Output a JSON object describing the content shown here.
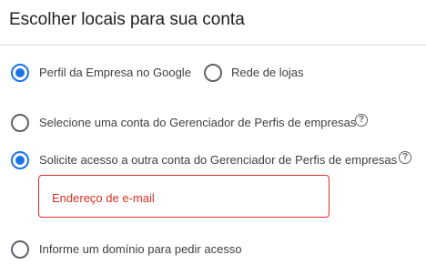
{
  "dialog": {
    "title": "Escolher locais para sua conta"
  },
  "source_options": [
    {
      "label": "Perfil da Empresa no Google",
      "selected": true
    },
    {
      "label": "Rede de lojas",
      "selected": false
    }
  ],
  "access_options": [
    {
      "label": "Selecione uma conta do Gerenciador de Perfis de empresas",
      "selected": false,
      "help_icon": "help-circle-icon"
    },
    {
      "label": "Solicite acesso a outra conta do Gerenciador de Perfis de empresas",
      "selected": true,
      "help_icon": "help-circle-icon"
    },
    {
      "label": "Informe um domínio para pedir acesso",
      "selected": false
    }
  ],
  "email_field": {
    "placeholder": "Endereço de e-mail",
    "value": ""
  },
  "colors": {
    "accent": "#1a73e8",
    "error": "#d93025",
    "text": "#3c4043",
    "divider": "#dadce0"
  }
}
